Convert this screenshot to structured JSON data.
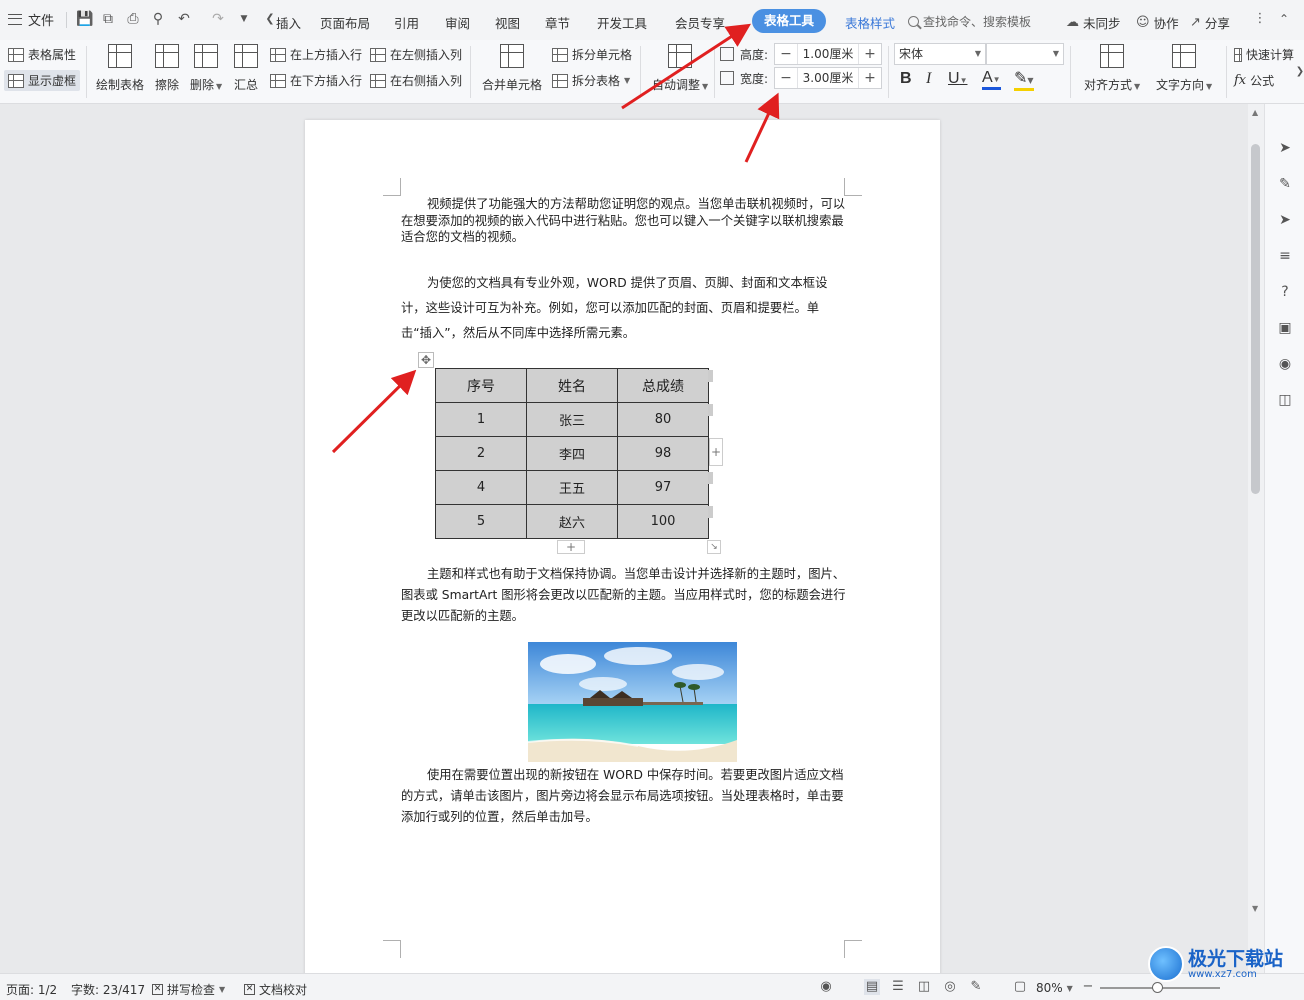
{
  "menubar": {
    "file_label": "文件",
    "tabs": [
      "插入",
      "页面布局",
      "引用",
      "审阅",
      "视图",
      "章节",
      "开发工具",
      "会员专享"
    ],
    "active_tab": "表格工具",
    "style_tab": "表格样式",
    "search_placeholder": "查找命令、搜索模板",
    "sync_label": "未同步",
    "collab_label": "协作",
    "share_label": "分享"
  },
  "ribbon": {
    "table_props": "表格属性",
    "show_gridlines": "显示虚框",
    "draw_table": "绘制表格",
    "erase": "擦除",
    "delete": "删除",
    "summary": "汇总",
    "insert_above": "在上方插入行",
    "insert_below": "在下方插入行",
    "insert_left": "在左侧插入列",
    "insert_right": "在右侧插入列",
    "merge_cells": "合并单元格",
    "split_cells": "拆分单元格",
    "split_table": "拆分表格",
    "auto_fit": "自动调整",
    "height_label": "高度:",
    "height_value": "1.00厘米",
    "width_label": "宽度:",
    "width_value": "3.00厘米",
    "font_name": "宋体",
    "align": "对齐方式",
    "text_direction": "文字方向",
    "quick_calc": "快速计算",
    "formula": "公式"
  },
  "document": {
    "para1": "视频提供了功能强大的方法帮助您证明您的观点。当您单击联机视频时，可以在想要添加的视频的嵌入代码中进行粘贴。您也可以键入一个关键字以联机搜索最适合您的文档的视频。",
    "para2": "为使您的文档具有专业外观，WORD 提供了页眉、页脚、封面和文本框设计，这些设计可互为补充。例如，您可以添加匹配的封面、页眉和提要栏。单击“插入”，然后从不同库中选择所需元素。",
    "table": {
      "headers": [
        "序号",
        "姓名",
        "总成绩"
      ],
      "rows": [
        [
          "1",
          "张三",
          "80"
        ],
        [
          "2",
          "李四",
          "98"
        ],
        [
          "4",
          "王五",
          "97"
        ],
        [
          "5",
          "赵六",
          "100"
        ]
      ]
    },
    "para3": "主题和样式也有助于文档保持协调。当您单击设计并选择新的主题时，图片、图表或 SmartArt 图形将会更改以匹配新的主题。当应用样式时，您的标题会进行更改以匹配新的主题。",
    "para4": "使用在需要位置出现的新按钮在 WORD 中保存时间。若要更改图片适应文档的方式，请单击该图片，图片旁边将会显示布局选项按钮。当处理表格时，单击要添加行或列的位置，然后单击加号。"
  },
  "statusbar": {
    "page": "页面: 1/2",
    "words": "字数: 23/417",
    "spellcheck": "拼写检查",
    "doc_check": "文档校对",
    "zoom": "80%"
  },
  "watermark": {
    "text": "极光下载站",
    "url": "www.xz7.com"
  },
  "colors": {
    "accent": "#4a90e2",
    "annotation_arrow": "#e02020",
    "table_fill": "#d0d0d0"
  }
}
